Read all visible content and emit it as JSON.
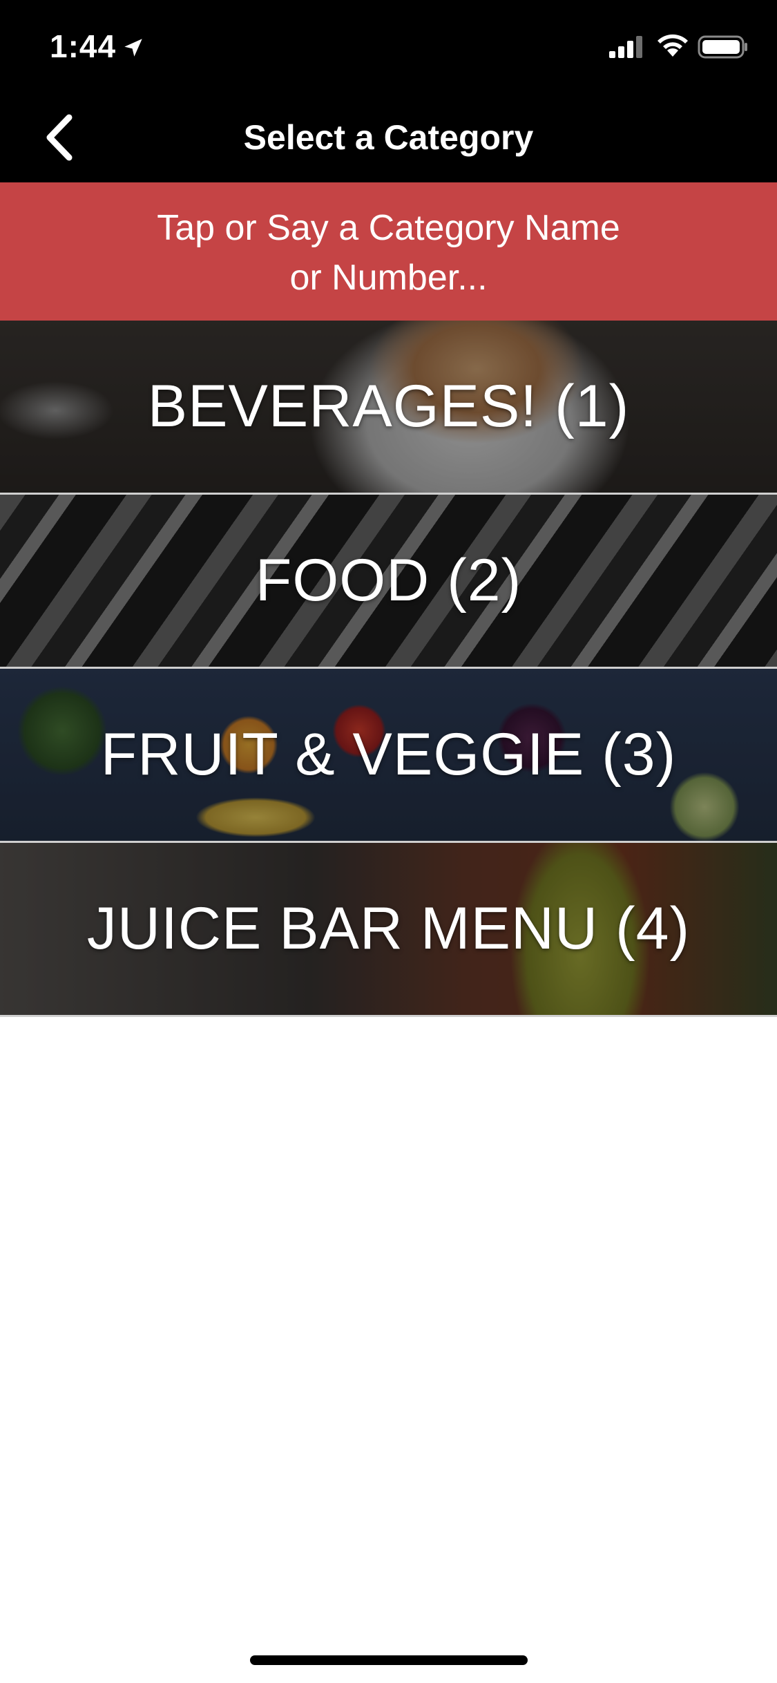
{
  "status_bar": {
    "time": "1:44",
    "location_icon": "location-arrow-icon",
    "signal_icon": "cellular-signal-icon",
    "wifi_icon": "wifi-icon",
    "battery_icon": "battery-icon"
  },
  "nav": {
    "title": "Select a Category",
    "back_icon": "chevron-left-icon"
  },
  "banner": {
    "line1": "Tap or Say a Category Name",
    "line2": "or Number..."
  },
  "categories": [
    {
      "label": "BEVERAGES! (1)"
    },
    {
      "label": "FOOD (2)"
    },
    {
      "label": "FRUIT & VEGGIE (3)"
    },
    {
      "label": "JUICE BAR MENU (4)"
    }
  ],
  "colors": {
    "banner_background": "#c54445",
    "nav_background": "#000000",
    "text": "#ffffff"
  }
}
